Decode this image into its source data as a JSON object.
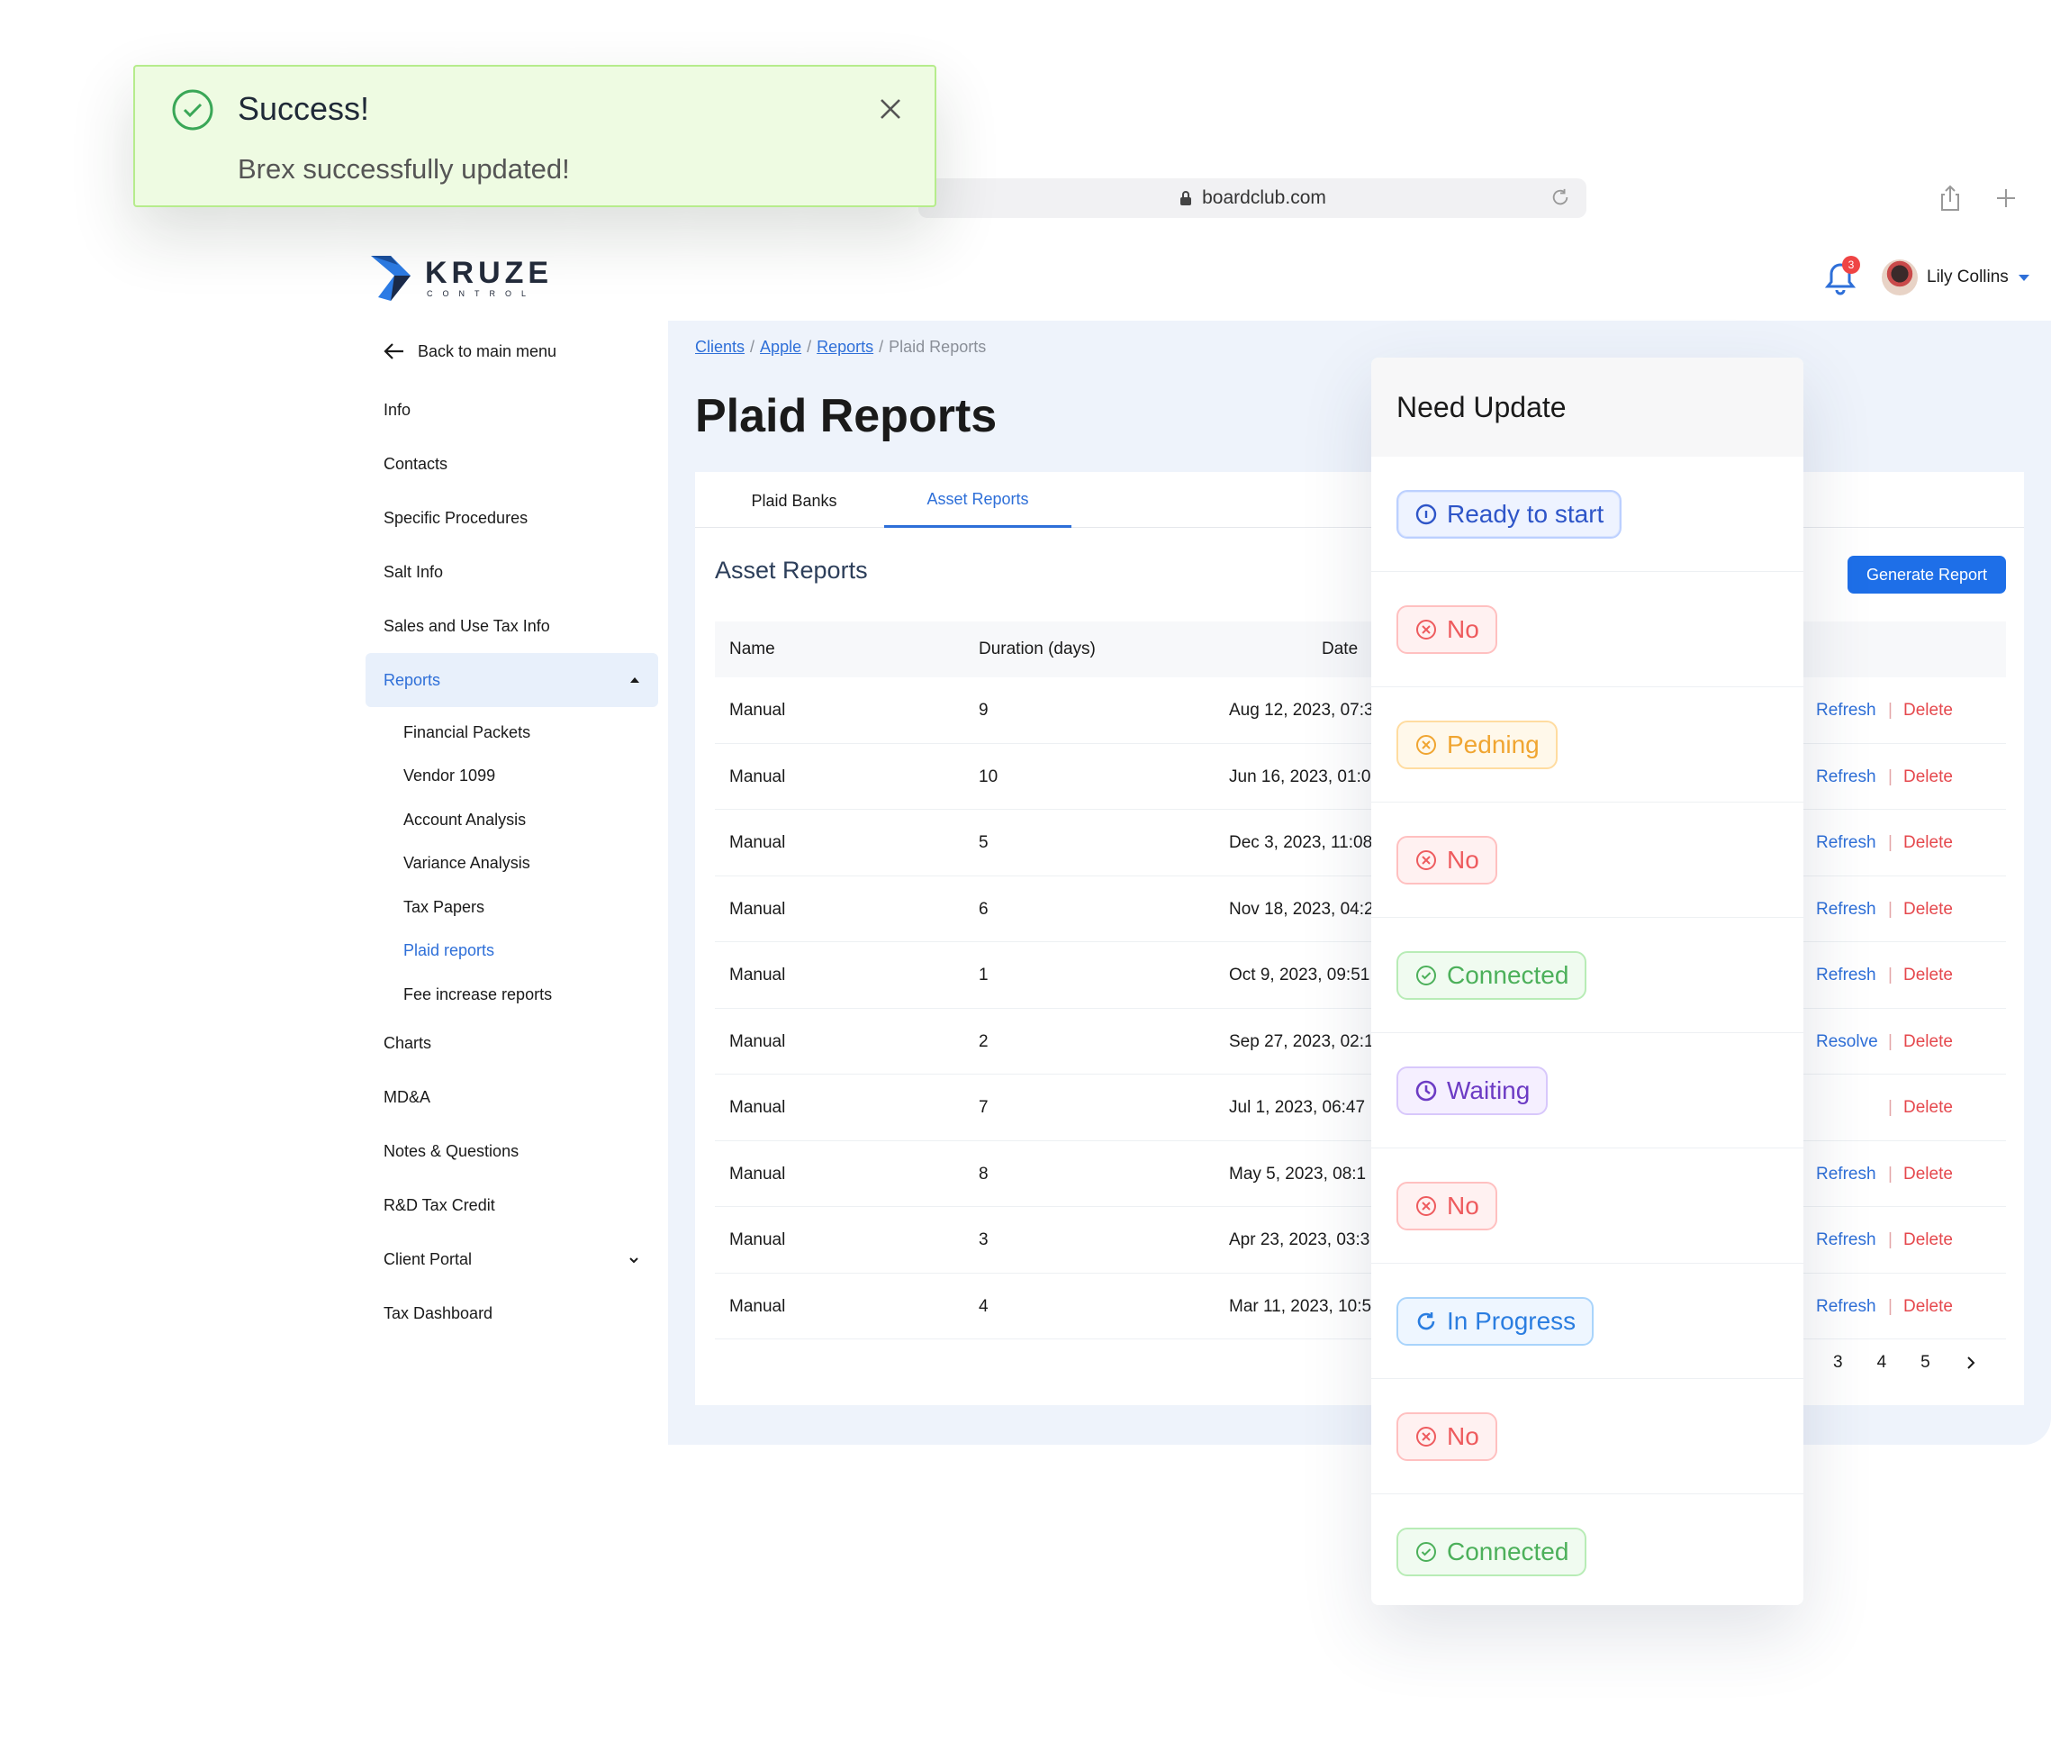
{
  "browser": {
    "url": "boardclub.com"
  },
  "brand": {
    "name": "KRUZE",
    "tagline": "CONTROL"
  },
  "header": {
    "notifications_count": "3",
    "user_name": "Lily Collins"
  },
  "sidebar": {
    "back_label": "Back to main menu",
    "items_top": [
      "Info",
      "Contacts",
      "Specific Procedures",
      "Salt Info",
      "Sales and Use Tax Info"
    ],
    "reports_label": "Reports",
    "report_subitems": [
      "Financial Packets",
      "Vendor 1099",
      "Account Analysis",
      "Variance Analysis",
      "Tax Papers",
      "Plaid reports",
      "Fee increase reports"
    ],
    "items_bottom": [
      "Charts",
      "MD&A",
      "Notes & Questions",
      "R&D Tax Credit",
      "Client Portal",
      "Tax Dashboard"
    ]
  },
  "breadcrumb": {
    "items": [
      "Clients",
      "Apple",
      "Reports"
    ],
    "current": "Plaid Reports",
    "sep": "/"
  },
  "page": {
    "title": "Plaid Reports"
  },
  "tabs": [
    "Plaid Banks",
    "Asset Reports"
  ],
  "section": {
    "title": "Asset Reports",
    "generate_button": "Generate Report"
  },
  "table": {
    "headers": [
      "Name",
      "Duration (days)",
      "Date"
    ],
    "rows": [
      {
        "name": "Manual",
        "duration": "9",
        "date": "Aug 12, 2023, 07:3",
        "action": "Refresh",
        "delete": "Delete"
      },
      {
        "name": "Manual",
        "duration": "10",
        "date": "Jun 16, 2023, 01:0",
        "action": "Refresh",
        "delete": "Delete"
      },
      {
        "name": "Manual",
        "duration": "5",
        "date": "Dec 3, 2023, 11:08",
        "action": "Refresh",
        "delete": "Delete"
      },
      {
        "name": "Manual",
        "duration": "6",
        "date": "Nov 18, 2023, 04:2",
        "action": "Refresh",
        "delete": "Delete"
      },
      {
        "name": "Manual",
        "duration": "1",
        "date": "Oct 9, 2023, 09:51",
        "action": "Refresh",
        "delete": "Delete"
      },
      {
        "name": "Manual",
        "duration": "2",
        "date": "Sep 27, 2023, 02:1",
        "action": "Resolve",
        "delete": "Delete"
      },
      {
        "name": "Manual",
        "duration": "7",
        "date": "Jul 1, 2023, 06:47",
        "action": "",
        "delete": "Delete"
      },
      {
        "name": "Manual",
        "duration": "8",
        "date": "May 5, 2023, 08:1",
        "action": "Refresh",
        "delete": "Delete"
      },
      {
        "name": "Manual",
        "duration": "3",
        "date": "Apr 23, 2023, 03:3",
        "action": "Refresh",
        "delete": "Delete"
      },
      {
        "name": "Manual",
        "duration": "4",
        "date": "Mar 11, 2023, 10:5",
        "action": "Refresh",
        "delete": "Delete"
      }
    ],
    "separator": "|"
  },
  "pagination": {
    "pages": [
      "3",
      "4",
      "5"
    ]
  },
  "status_panel": {
    "title": "Need Update",
    "statuses": [
      {
        "label": "Ready to start",
        "style": "blue",
        "icon": "info-icon"
      },
      {
        "label": "No",
        "style": "red",
        "icon": "x-circle-icon"
      },
      {
        "label": "Pedning",
        "style": "orange",
        "icon": "x-circle-icon"
      },
      {
        "label": "No",
        "style": "red",
        "icon": "x-circle-icon"
      },
      {
        "label": "Connected",
        "style": "green",
        "icon": "check-circle-icon"
      },
      {
        "label": "Waiting",
        "style": "purple",
        "icon": "clock-icon"
      },
      {
        "label": "No",
        "style": "red",
        "icon": "x-circle-icon"
      },
      {
        "label": "In Progress",
        "style": "sky",
        "icon": "refresh-icon"
      },
      {
        "label": "No",
        "style": "red",
        "icon": "x-circle-icon"
      },
      {
        "label": "Connected",
        "style": "green",
        "icon": "check-circle-icon"
      }
    ]
  },
  "toast": {
    "title": "Success!",
    "message": "Brex successfully updated!"
  },
  "colors": {
    "accent": "#2e6fd8",
    "danger": "#e5484d",
    "toast_bg": "#eefbe2",
    "toast_border": "#b6ec8c",
    "main_bg": "#eef3fb"
  }
}
